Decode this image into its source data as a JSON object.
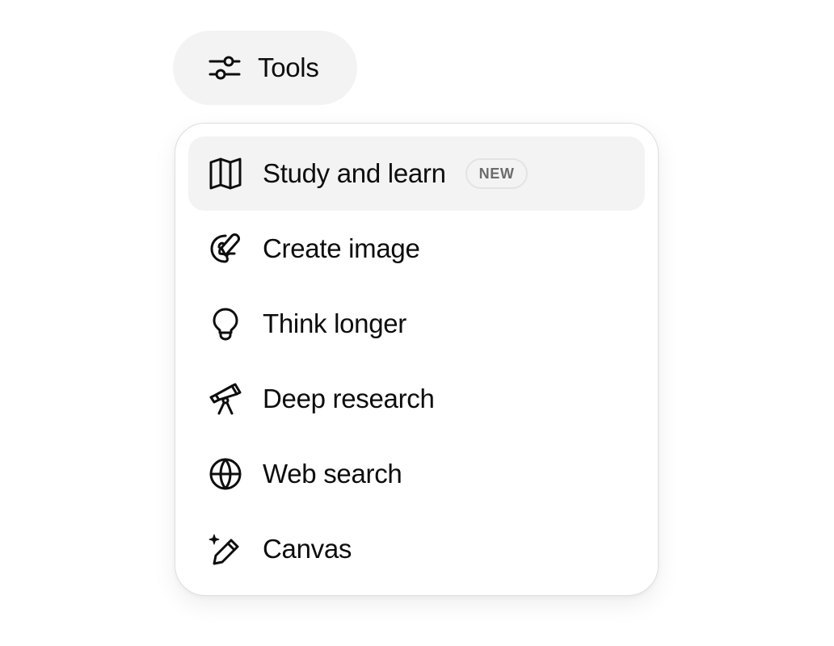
{
  "tools_button": {
    "label": "Tools",
    "icon": "sliders-icon"
  },
  "menu": {
    "items": [
      {
        "label": "Study and learn",
        "icon": "book-open-icon",
        "badge": "NEW",
        "highlighted": true
      },
      {
        "label": "Create image",
        "icon": "palette-brush-icon"
      },
      {
        "label": "Think longer",
        "icon": "lightbulb-icon"
      },
      {
        "label": "Deep research",
        "icon": "telescope-icon"
      },
      {
        "label": "Web search",
        "icon": "globe-icon"
      },
      {
        "label": "Canvas",
        "icon": "pencil-sparkle-icon"
      }
    ]
  },
  "colors": {
    "highlight_bg": "#f3f3f3",
    "text": "#0d0d0d",
    "badge_text": "#6b6b6b",
    "border": "#dedede"
  }
}
